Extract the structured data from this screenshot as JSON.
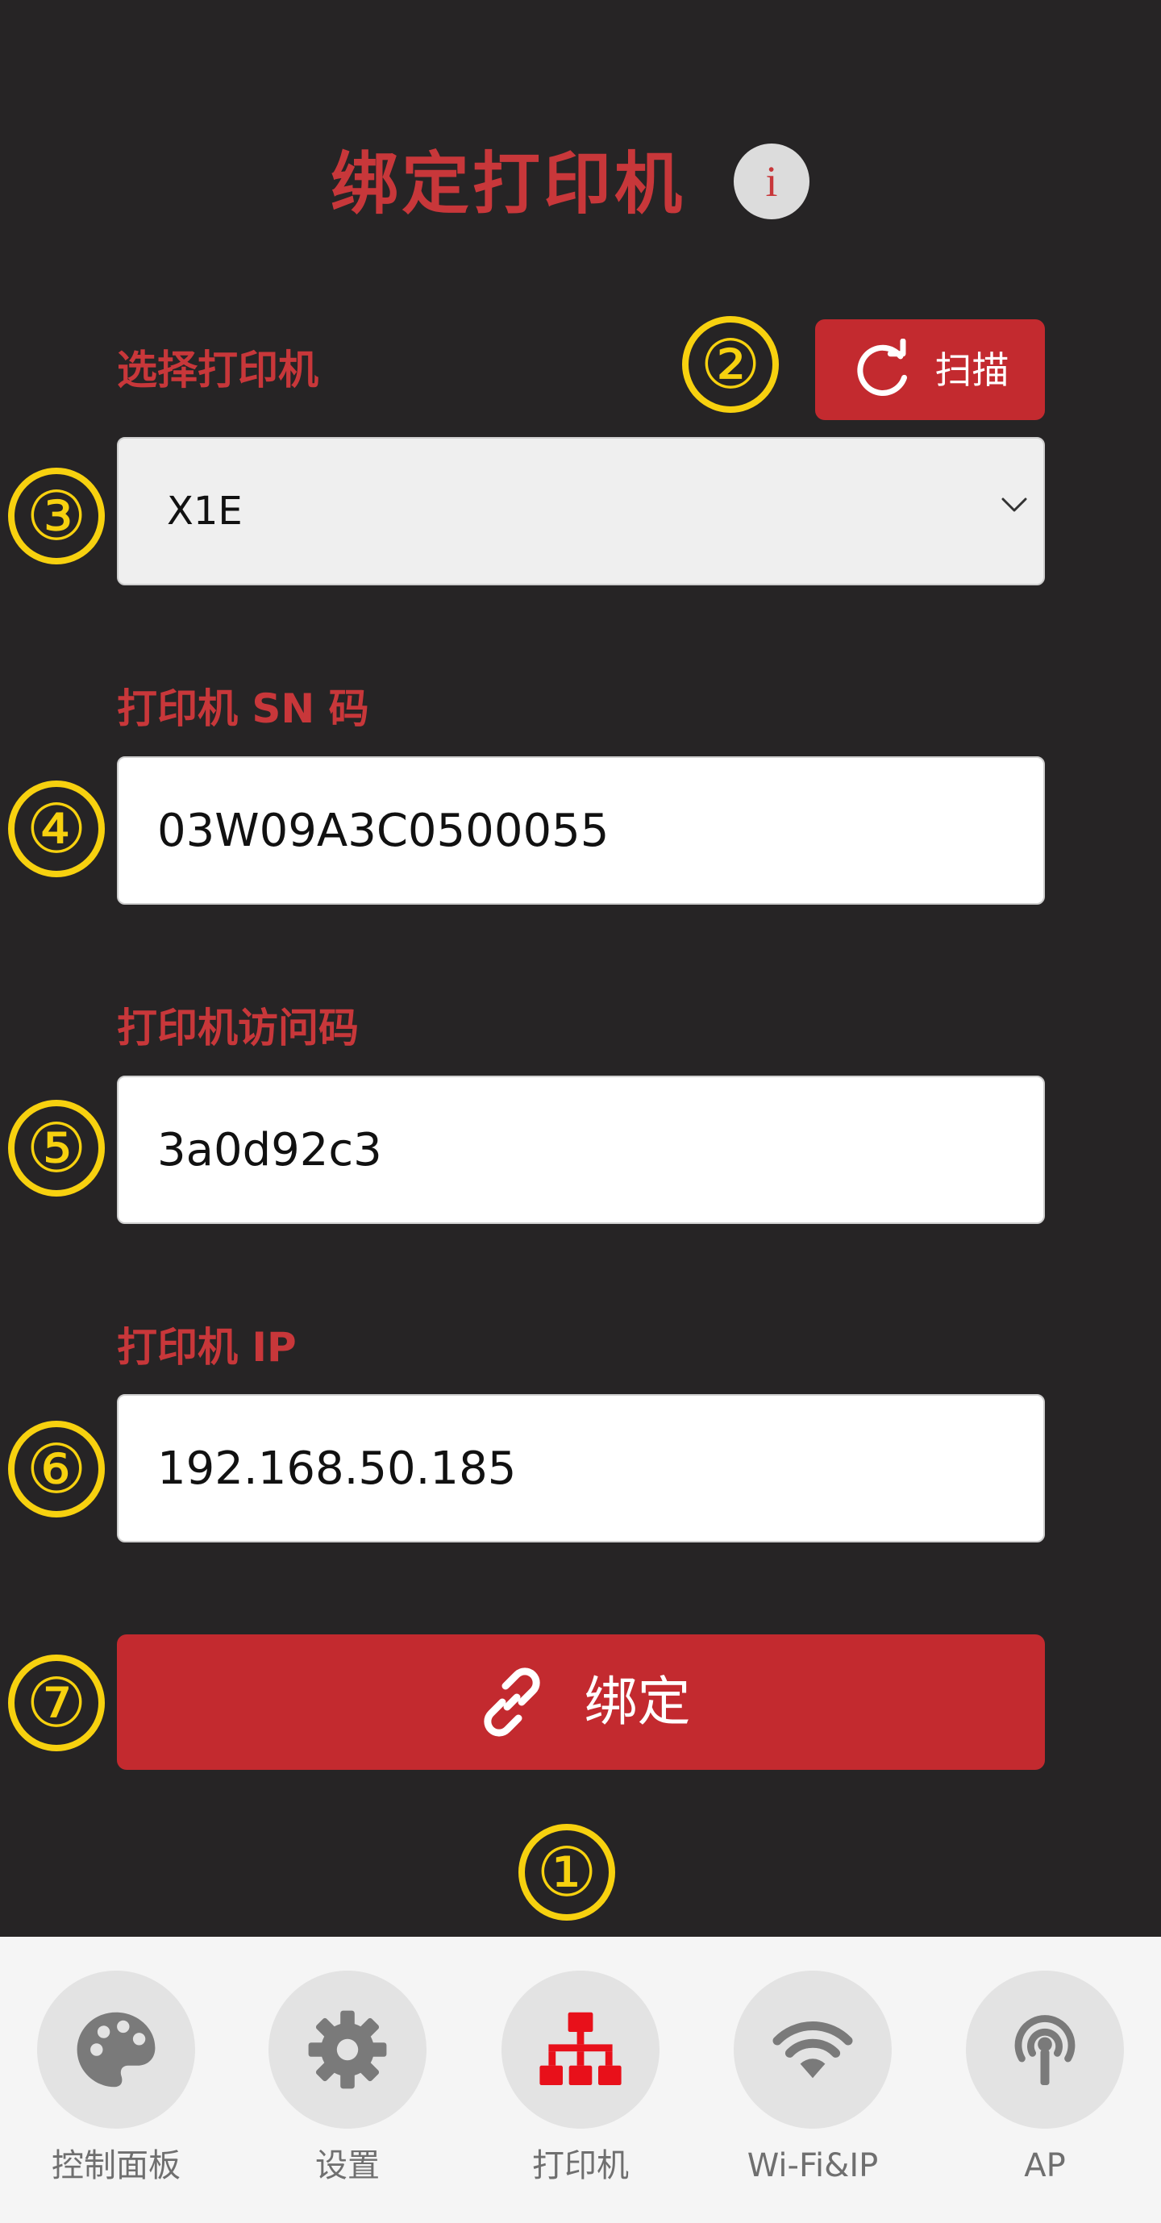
{
  "header": {
    "title": "绑定打印机",
    "info_glyph": "i"
  },
  "select_printer": {
    "label": "选择打印机",
    "value": "X1E",
    "scan_label": "扫描"
  },
  "sn": {
    "label": "打印机 SN 码",
    "value": "03W09A3C0500055"
  },
  "access_code": {
    "label": "打印机访问码",
    "value": "3a0d92c3"
  },
  "ip": {
    "label": "打印机 IP",
    "value": "192.168.50.185"
  },
  "bind_button": {
    "label": "绑定"
  },
  "markers": {
    "m1": "①",
    "m2": "②",
    "m3": "③",
    "m4": "④",
    "m5": "⑤",
    "m6": "⑥",
    "m7": "⑦"
  },
  "nav": {
    "items": [
      {
        "label": "控制面板",
        "icon": "palette-icon"
      },
      {
        "label": "设置",
        "icon": "gear-icon"
      },
      {
        "label": "打印机",
        "icon": "network-tree-icon",
        "active": true
      },
      {
        "label": "Wi-Fi&IP",
        "icon": "wifi-icon"
      },
      {
        "label": "AP",
        "icon": "antenna-icon"
      }
    ]
  },
  "colors": {
    "background": "#262425",
    "accent_red": "#c32a2f",
    "label_red": "#c8373a",
    "marker_yellow": "#f7d10f",
    "nav_bg": "#f5f5f5"
  }
}
